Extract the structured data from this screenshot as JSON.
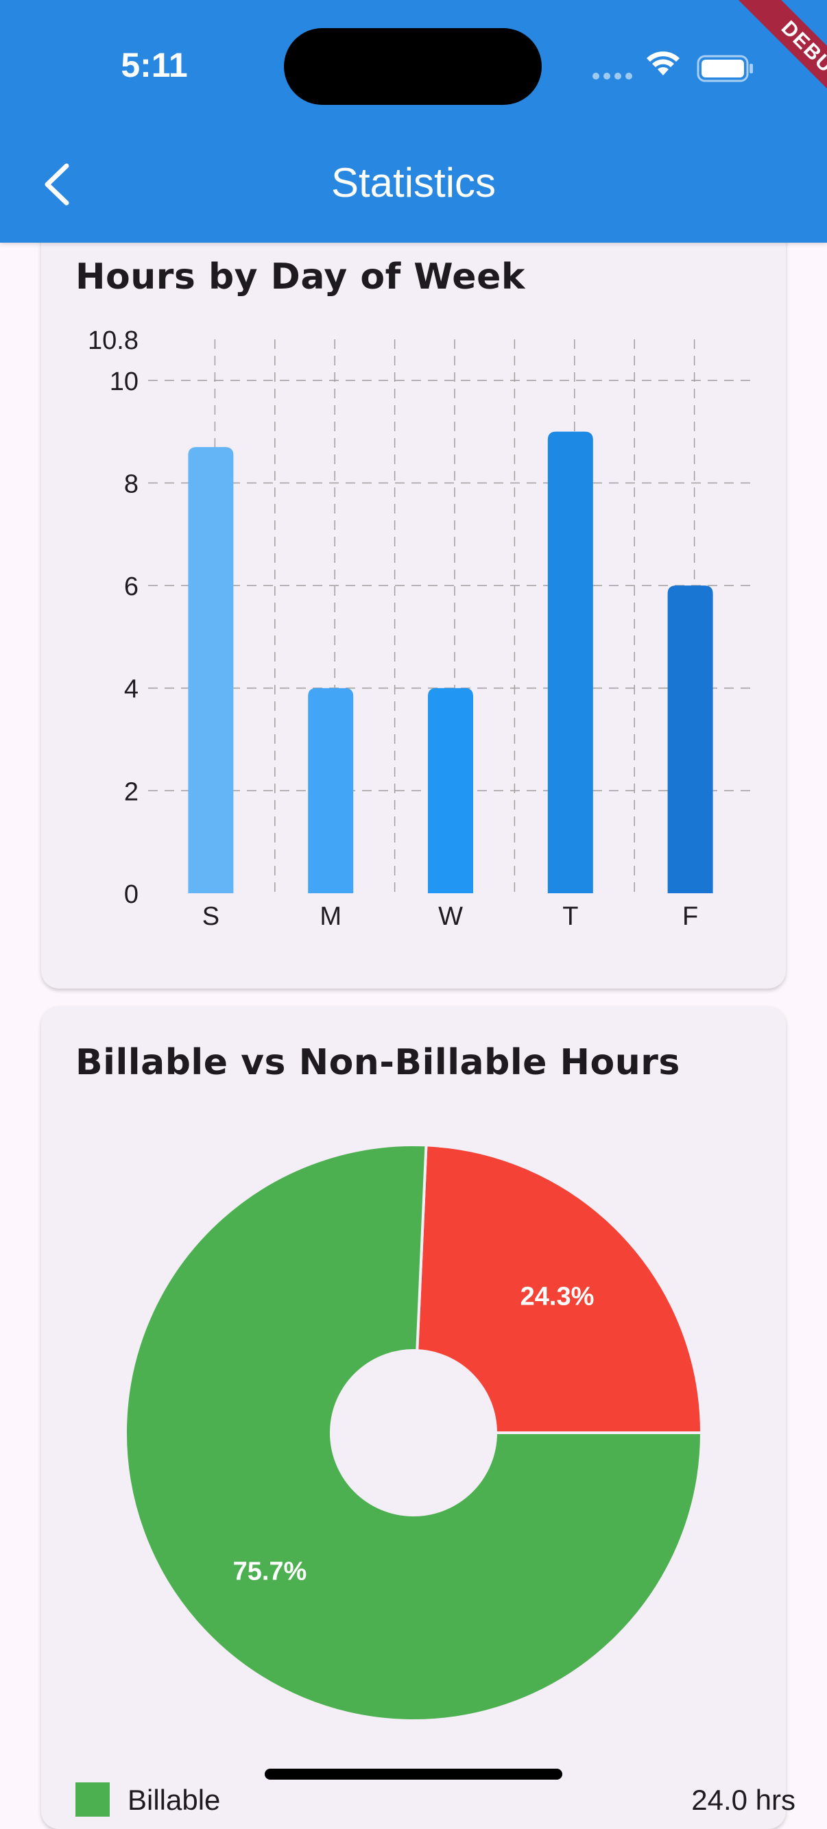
{
  "status_bar": {
    "time": "5:11"
  },
  "app_bar": {
    "title": "Statistics",
    "back_icon": "chevron-left-icon"
  },
  "debug_banner": "DEBUG",
  "hours_card": {
    "title": "Hours by Day of Week"
  },
  "billable_card": {
    "title": "Billable vs Non-Billable Hours",
    "legend": [
      {
        "label": "Billable",
        "value": "24.0 hrs",
        "color": "#4caf50"
      }
    ]
  },
  "colors": {
    "app_bar": "#2887e0",
    "billable": "#4caf50",
    "non_billable": "#f44336"
  },
  "chart_data": [
    {
      "type": "bar",
      "title": "Hours by Day of Week",
      "categories": [
        "S",
        "M",
        "W",
        "T",
        "F"
      ],
      "values": [
        8.7,
        4.0,
        4.0,
        9.0,
        6.0
      ],
      "bar_colors": [
        "#64b5f6",
        "#42a5f5",
        "#2196f3",
        "#1e88e5",
        "#1976d2"
      ],
      "ylim": [
        0,
        10.8
      ],
      "yticks": [
        "0",
        "2",
        "4",
        "6",
        "8",
        "10",
        "10.8"
      ],
      "grid": true
    },
    {
      "type": "pie",
      "title": "Billable vs Non-Billable Hours",
      "slices": [
        {
          "value": 75.7,
          "label": "75.7%",
          "color": "#4caf50"
        },
        {
          "value": 24.3,
          "label": "24.3%",
          "color": "#f44336"
        }
      ]
    }
  ]
}
